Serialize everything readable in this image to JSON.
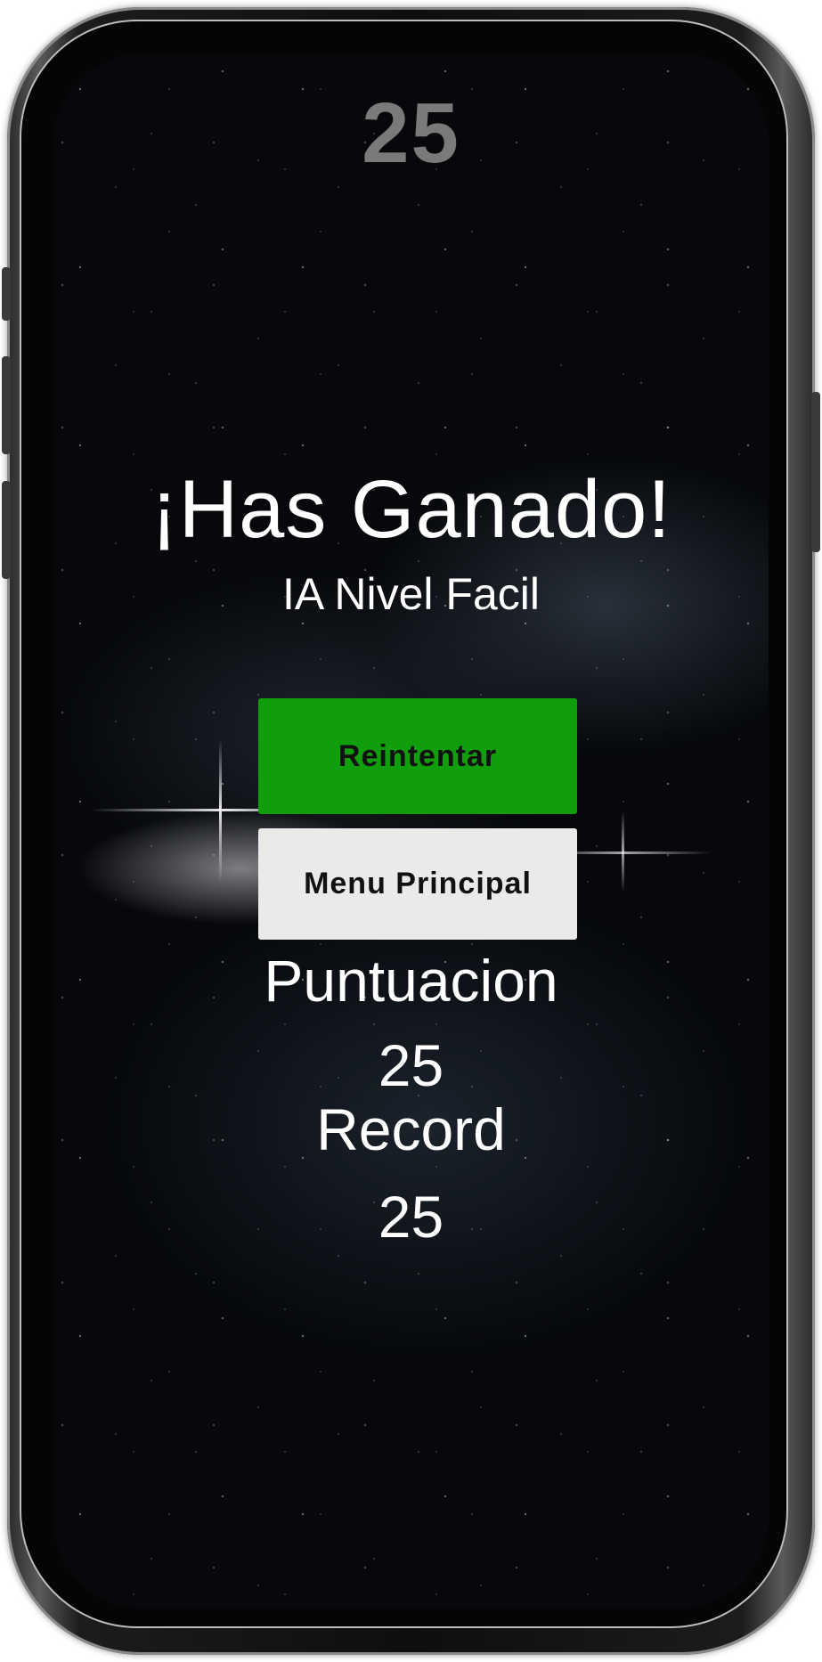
{
  "game": {
    "current_score": "25",
    "title": "¡Has Ganado!",
    "subtitle": "IA Nivel Facil",
    "retry_label": "Reintentar",
    "menu_label": "Menu Principal",
    "score_label": "Puntuacion",
    "score_value": "25",
    "record_label": "Record",
    "record_value": "25"
  },
  "colors": {
    "retry_button": "#119e0c",
    "menu_button": "#ece9e9",
    "top_score": "#7a7a7a",
    "text": "#ffffff",
    "background": "#06080b"
  }
}
